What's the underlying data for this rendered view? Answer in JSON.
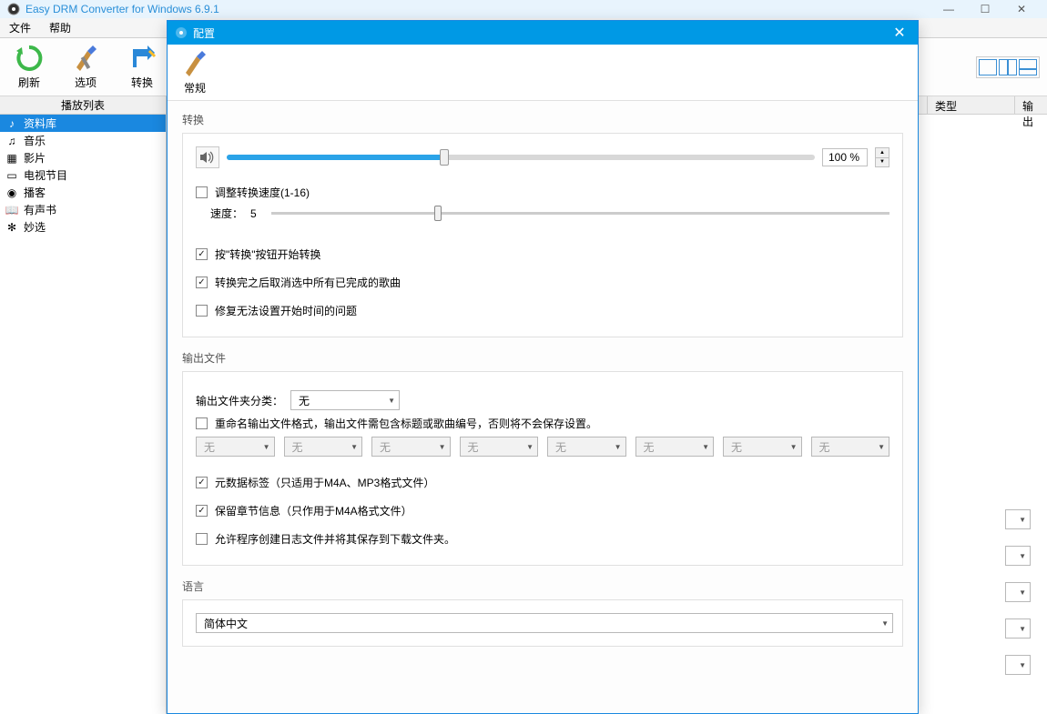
{
  "window": {
    "title": "Easy DRM Converter for Windows 6.9.1"
  },
  "menubar": {
    "file": "文件",
    "help": "帮助"
  },
  "toolbar": {
    "refresh": "刷新",
    "options": "选项",
    "convert": "转换"
  },
  "sidebar": {
    "header": "播放列表",
    "items": [
      {
        "label": "资料库"
      },
      {
        "label": "音乐"
      },
      {
        "label": "影片"
      },
      {
        "label": "电视节目"
      },
      {
        "label": "播客"
      },
      {
        "label": "有声书"
      },
      {
        "label": "妙选"
      }
    ]
  },
  "columns": {
    "type": "类型",
    "output": "输出"
  },
  "dialog": {
    "title": "配置",
    "tab_general": "常规",
    "sections": {
      "convert": {
        "title": "转换",
        "volume_pct": "100 %",
        "volume_fill_pct": 37,
        "adjust_speed_label": "调整转换速度(1-16)",
        "adjust_speed_checked": false,
        "speed_prefix": "速度：",
        "speed_value": "5",
        "speed_thumb_pct": 27,
        "start_convert_label": "按\"转换\"按钮开始转换",
        "start_convert_checked": true,
        "uncheck_done_label": "转换完之后取消选中所有已完成的歌曲",
        "uncheck_done_checked": true,
        "fix_time_label": "修复无法设置开始时间的问题",
        "fix_time_checked": false
      },
      "output": {
        "title": "输出文件",
        "folder_sort_label": "输出文件夹分类：",
        "folder_sort_value": "无",
        "rename_label": "重命名输出文件格式，输出文件需包含标题或歌曲编号，否则将不会保存设置。",
        "rename_checked": false,
        "rename_field_value": "无",
        "metadata_label": "元数据标签（只适用于M4A、MP3格式文件）",
        "metadata_checked": true,
        "chapter_label": "保留章节信息（只作用于M4A格式文件）",
        "chapter_checked": true,
        "logfile_label": "允许程序创建日志文件并将其保存到下载文件夹。",
        "logfile_checked": false
      },
      "language": {
        "title": "语言",
        "value": "简体中文"
      }
    }
  }
}
